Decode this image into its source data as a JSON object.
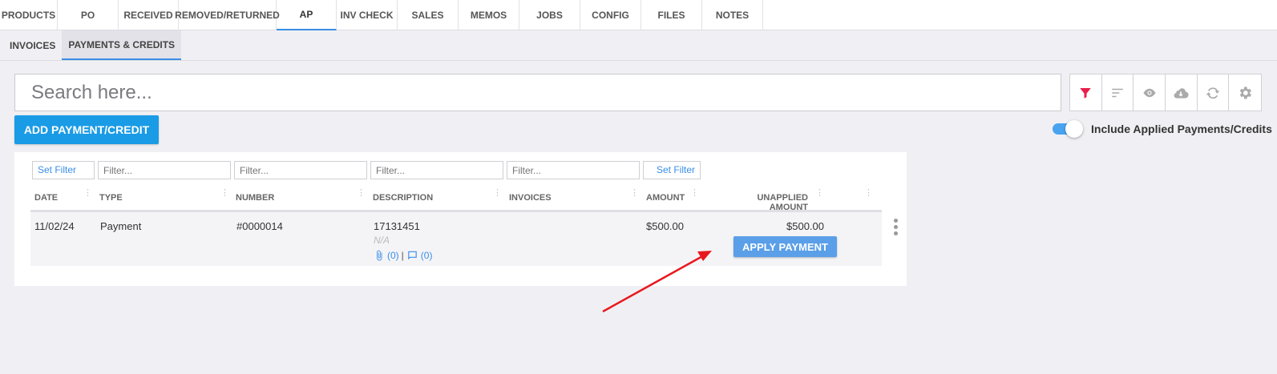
{
  "top_tabs": [
    {
      "label": "PRODUCTS"
    },
    {
      "label": "PO"
    },
    {
      "label": "RECEIVED"
    },
    {
      "label": "REMOVED/RETURNED"
    },
    {
      "label": "AP"
    },
    {
      "label": "INV CHECK"
    },
    {
      "label": "SALES"
    },
    {
      "label": "MEMOS"
    },
    {
      "label": "JOBS"
    },
    {
      "label": "CONFIG"
    },
    {
      "label": "FILES"
    },
    {
      "label": "NOTES"
    }
  ],
  "active_top_tab": "AP",
  "sub_tabs": [
    {
      "label": "INVOICES"
    },
    {
      "label": "PAYMENTS & CREDITS"
    }
  ],
  "active_sub_tab": "PAYMENTS & CREDITS",
  "search": {
    "placeholder": "Search here...",
    "value": ""
  },
  "toolbar": {
    "icons": [
      "filter-icon",
      "sort-icon",
      "eye-icon",
      "cloud-download-icon",
      "refresh-icon",
      "gear-icon"
    ],
    "filter_color": "#e8204a"
  },
  "actions": {
    "add_label": "ADD PAYMENT/CREDIT"
  },
  "toggle": {
    "label": "Include Applied Payments/Credits",
    "on": true
  },
  "grid": {
    "filters": {
      "set_filter_label": "Set Filter",
      "placeholder": "Filter..."
    },
    "columns": [
      "DATE",
      "TYPE",
      "NUMBER",
      "DESCRIPTION",
      "INVOICES",
      "AMOUNT",
      "UNAPPLIED AMOUNT"
    ],
    "rows": [
      {
        "date": "11/02/24",
        "type": "Payment",
        "number": "#0000014",
        "description": "17131451",
        "description_sub": "N/A",
        "attachments": "(0)",
        "separator": "|",
        "comments": "(0)",
        "invoices": "",
        "amount": "$500.00",
        "unapplied_amount": "$500.00",
        "action_label": "APPLY PAYMENT"
      }
    ]
  },
  "colors": {
    "primary": "#1a9be6",
    "apply_button": "#5a9fe8",
    "annotation_arrow": "#e8181e"
  }
}
